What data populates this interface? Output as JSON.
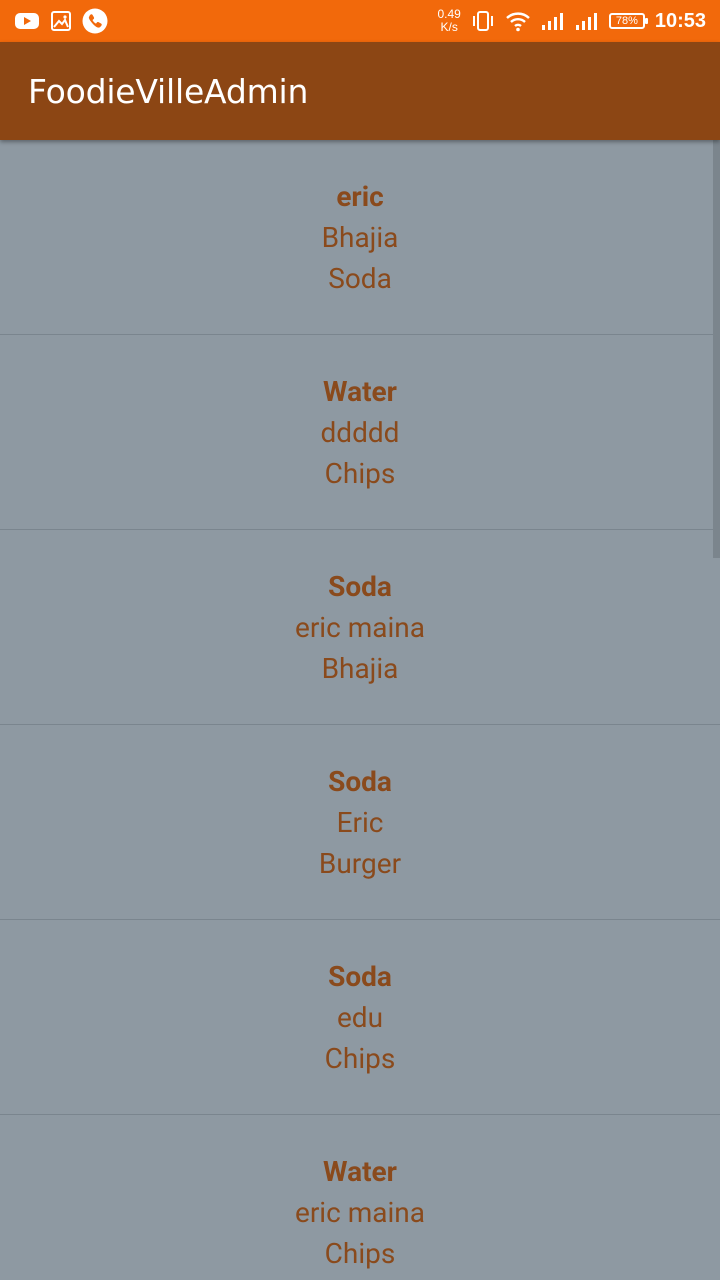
{
  "status_bar": {
    "net_speed_value": "0.49",
    "net_speed_unit": "K/s",
    "battery": "78%",
    "time": "10:53",
    "icons": [
      "youtube-icon",
      "gallery-icon",
      "phone-icon",
      "vibrate-icon",
      "wifi-icon",
      "signal-icon",
      "signal-icon",
      "battery-icon"
    ]
  },
  "app_bar": {
    "title": "FoodieVilleAdmin"
  },
  "orders": [
    {
      "title": "eric",
      "line1": "Bhajia",
      "line2": "Soda"
    },
    {
      "title": "Water",
      "line1": "ddddd",
      "line2": "Chips"
    },
    {
      "title": "Soda",
      "line1": "eric maina",
      "line2": "Bhajia"
    },
    {
      "title": "Soda",
      "line1": "Eric",
      "line2": "Burger"
    },
    {
      "title": "Soda",
      "line1": "edu",
      "line2": "Chips"
    },
    {
      "title": "Water",
      "line1": "eric maina",
      "line2": "Chips"
    }
  ],
  "colors": {
    "status_bar": "#f2690b",
    "app_bar": "#8c4614",
    "background": "#8e99a2",
    "item_text": "#8a4a1c"
  }
}
